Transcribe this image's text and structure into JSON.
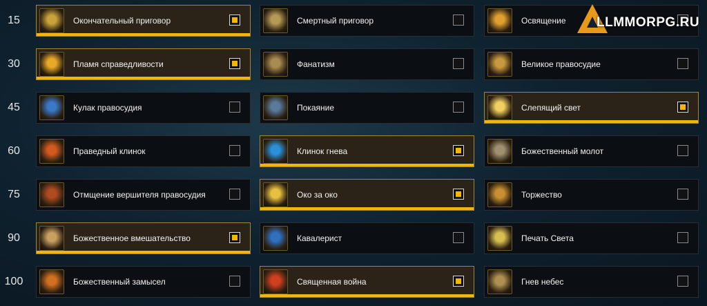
{
  "logo": {
    "text": "LLMMORPG.RU"
  },
  "rows": [
    {
      "level": "15",
      "talents": [
        {
          "name": "Окончательный приговор",
          "selected": true,
          "icon": "hammer-verdict-icon",
          "color": "#c9a23a"
        },
        {
          "name": "Смертный приговор",
          "selected": false,
          "icon": "execution-sentence-icon",
          "color": "#b49a55"
        },
        {
          "name": "Освящение",
          "selected": false,
          "icon": "consecration-icon",
          "color": "#e0a030"
        }
      ]
    },
    {
      "level": "30",
      "talents": [
        {
          "name": "Пламя справедливости",
          "selected": true,
          "icon": "flame-justice-icon",
          "color": "#e8a828"
        },
        {
          "name": "Фанатизм",
          "selected": false,
          "icon": "fanaticism-icon",
          "color": "#a88c50"
        },
        {
          "name": "Великое правосудие",
          "selected": false,
          "icon": "great-justice-icon",
          "color": "#c89a40"
        }
      ]
    },
    {
      "level": "45",
      "talents": [
        {
          "name": "Кулак правосудия",
          "selected": false,
          "icon": "fist-justice-icon",
          "color": "#3a78c8"
        },
        {
          "name": "Покаяние",
          "selected": false,
          "icon": "repentance-icon",
          "color": "#5a7a9a"
        },
        {
          "name": "Слепящий свет",
          "selected": true,
          "icon": "blinding-light-icon",
          "color": "#f0d060"
        }
      ]
    },
    {
      "level": "60",
      "talents": [
        {
          "name": "Праведный клинок",
          "selected": false,
          "icon": "righteous-blade-icon",
          "color": "#d05a20"
        },
        {
          "name": "Клинок гнева",
          "selected": true,
          "icon": "blade-wrath-icon",
          "color": "#2a90d8"
        },
        {
          "name": "Божественный молот",
          "selected": false,
          "icon": "divine-hammer-icon",
          "color": "#a09070"
        }
      ]
    },
    {
      "level": "75",
      "talents": [
        {
          "name": "Отмщение вершителя правосудия",
          "selected": false,
          "icon": "justicar-vengeance-icon",
          "color": "#b04a20"
        },
        {
          "name": "Око за око",
          "selected": true,
          "icon": "eye-for-eye-icon",
          "color": "#e8c040"
        },
        {
          "name": "Торжество",
          "selected": false,
          "icon": "triumph-icon",
          "color": "#c89030"
        }
      ]
    },
    {
      "level": "90",
      "talents": [
        {
          "name": "Божественное вмешательство",
          "selected": true,
          "icon": "divine-intervention-icon",
          "color": "#c8a060"
        },
        {
          "name": "Кавалерист",
          "selected": false,
          "icon": "cavalier-icon",
          "color": "#3070c0"
        },
        {
          "name": "Печать Света",
          "selected": false,
          "icon": "seal-light-icon",
          "color": "#d8c050"
        }
      ]
    },
    {
      "level": "100",
      "talents": [
        {
          "name": "Божественный замысел",
          "selected": false,
          "icon": "divine-purpose-icon",
          "color": "#d07020"
        },
        {
          "name": "Священная война",
          "selected": true,
          "icon": "crusade-icon",
          "color": "#d04020"
        },
        {
          "name": "Гнев небес",
          "selected": false,
          "icon": "holy-wrath-icon",
          "color": "#b09050"
        }
      ]
    }
  ]
}
